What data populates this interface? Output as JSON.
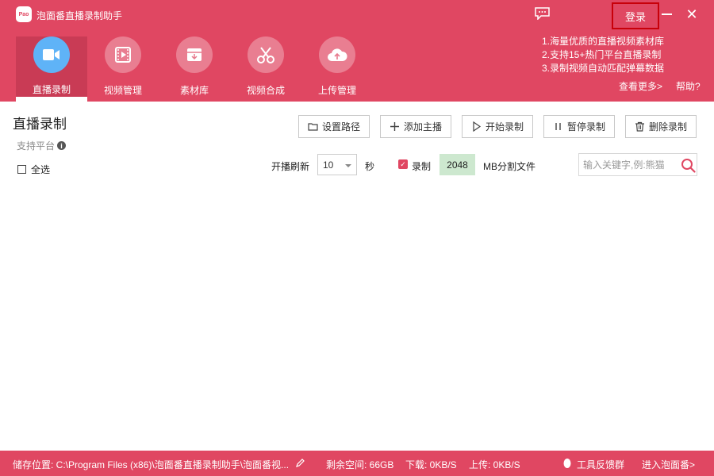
{
  "app": {
    "title": "泡面番直播录制助手",
    "logo_text": "Pao"
  },
  "header": {
    "login_label": "登录",
    "minimize_glyph": "—",
    "close_glyph": "✕"
  },
  "nav": [
    {
      "label": "直播录制",
      "icon": "video-camera-icon",
      "active": true
    },
    {
      "label": "视频管理",
      "icon": "film-icon",
      "active": false
    },
    {
      "label": "素材库",
      "icon": "download-box-icon",
      "active": false
    },
    {
      "label": "视频合成",
      "icon": "scissors-icon",
      "active": false
    },
    {
      "label": "上传管理",
      "icon": "cloud-upload-icon",
      "active": false
    }
  ],
  "tips": {
    "items": [
      "1.海量优质的直播视频素材库",
      "2.支持15+热门平台直播录制",
      "3.录制视频自动匹配弹幕数据"
    ],
    "more_label": "查看更多>",
    "help_label": "帮助?"
  },
  "main": {
    "title": "直播录制",
    "platform_label": "支持平台",
    "select_all_label": "全选",
    "toolbar": {
      "set_path": "设置路径",
      "add_host": "添加主播",
      "start_record": "开始录制",
      "pause_record": "暂停录制",
      "delete_record": "删除录制"
    },
    "refresh_label": "开播刷新",
    "refresh_value": "10",
    "seconds_label": "秒",
    "record_label": "录制",
    "record_checked": true,
    "split_size": "2048",
    "split_label": "MB分割文件",
    "search_placeholder": "输入关键字,例:熊猫"
  },
  "footer": {
    "storage_path": "储存位置: C:\\Program Files (x86)\\泡面番直播录制助手\\泡面番视...",
    "free_space": "剩余空间: 66GB",
    "download_speed": "下载: 0KB/S",
    "upload_speed": "上传: 0KB/S",
    "feedback_group": "工具反馈群",
    "enter_site": "进入泡面番>"
  },
  "colors": {
    "accent": "#e04762",
    "active_icon": "#5fb3f7",
    "split_bg": "#cde8cf"
  }
}
